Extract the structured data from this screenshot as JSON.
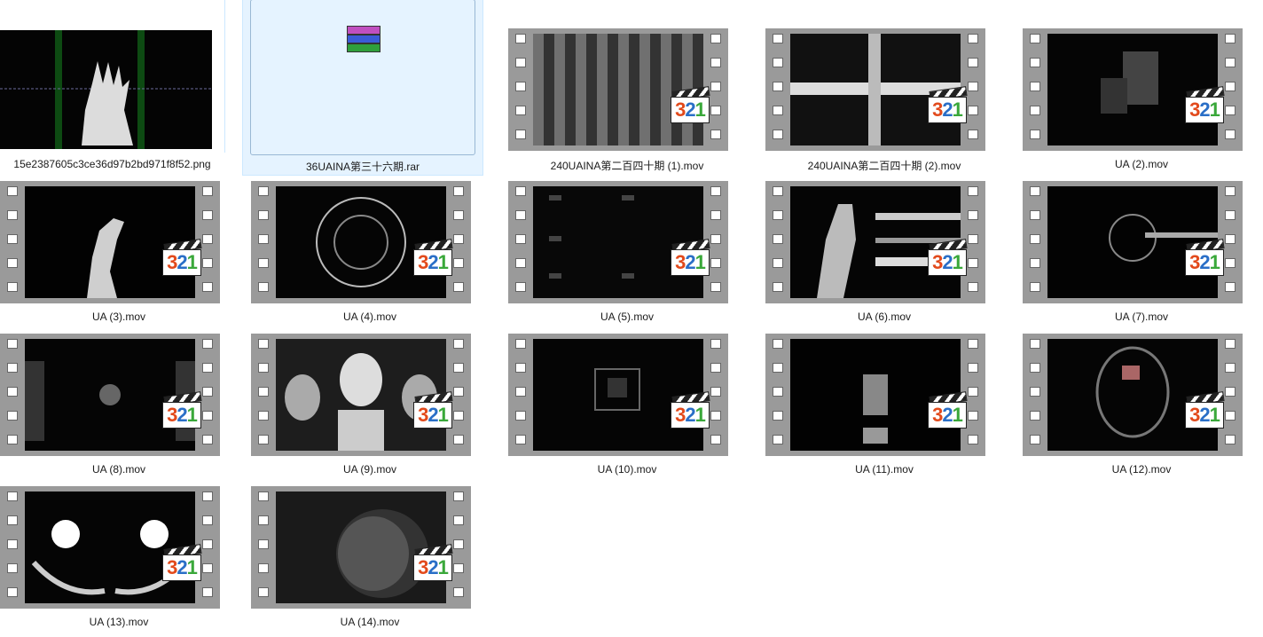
{
  "files": [
    {
      "name": "15e2387605c3ce36d97b2bd971f8f52.png",
      "kind": "png"
    },
    {
      "name": "36UAINA第三十六期.rar",
      "kind": "rar"
    },
    {
      "name": "240UAINA第二百四十期 (1).mov",
      "kind": "mov"
    },
    {
      "name": "240UAINA第二百四十期 (2).mov",
      "kind": "mov"
    },
    {
      "name": "UA (2).mov",
      "kind": "mov"
    },
    {
      "name": "UA (3).mov",
      "kind": "mov"
    },
    {
      "name": "UA (4).mov",
      "kind": "mov"
    },
    {
      "name": "UA (5).mov",
      "kind": "mov"
    },
    {
      "name": "UA (6).mov",
      "kind": "mov"
    },
    {
      "name": "UA (7).mov",
      "kind": "mov"
    },
    {
      "name": "UA (8).mov",
      "kind": "mov"
    },
    {
      "name": "UA (9).mov",
      "kind": "mov"
    },
    {
      "name": "UA (10).mov",
      "kind": "mov"
    },
    {
      "name": "UA (11).mov",
      "kind": "mov"
    },
    {
      "name": "UA (12).mov",
      "kind": "mov"
    },
    {
      "name": "UA (13).mov",
      "kind": "mov"
    },
    {
      "name": "UA (14).mov",
      "kind": "mov"
    }
  ],
  "player_badge": {
    "d3": "3",
    "d2": "2",
    "d1": "1"
  },
  "colors": {
    "selection": "#e5f3ff",
    "selection_border": "#cce8ff",
    "film": "#9a9a9a"
  }
}
